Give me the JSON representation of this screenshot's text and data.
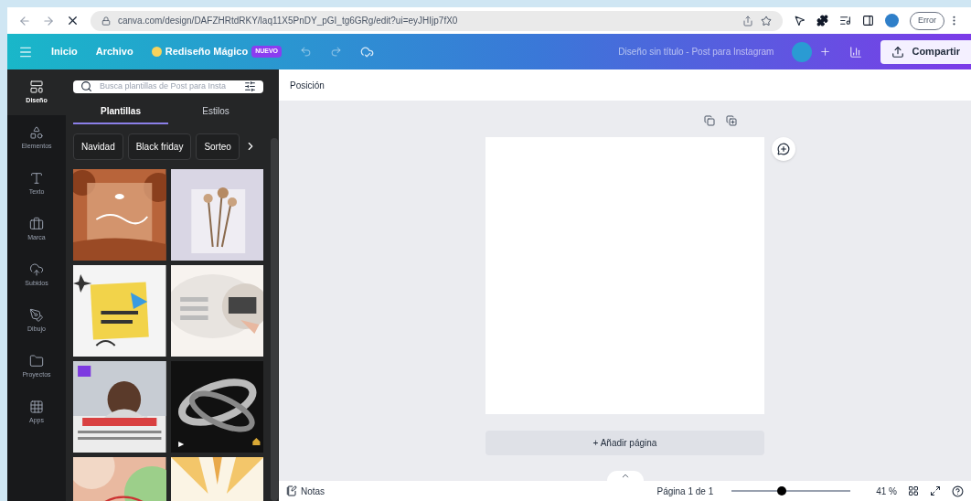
{
  "browser": {
    "url": "canva.com/design/DAFZHRtdRKY/laq11X5PnDY_pGI_tg6GRg/edit?ui=eyJHIjp7fX0",
    "profile_button": "Error"
  },
  "toolbar": {
    "menu": [
      "Inicio",
      "Archivo"
    ],
    "magic": {
      "label": "Rediseño Mágico",
      "badge": "NUEVO"
    },
    "title": "Diseño sin título - Post para Instagram",
    "share": "Compartir"
  },
  "rail": [
    {
      "kind": "design",
      "label": "Diseño",
      "selected": true
    },
    {
      "kind": "elements",
      "label": "Elementos",
      "selected": false
    },
    {
      "kind": "text",
      "label": "Texto",
      "selected": false
    },
    {
      "kind": "brand",
      "label": "Marca",
      "selected": false
    },
    {
      "kind": "uploads",
      "label": "Subidos",
      "selected": false
    },
    {
      "kind": "draw",
      "label": "Dibujo",
      "selected": false
    },
    {
      "kind": "projects",
      "label": "Proyectos",
      "selected": false
    },
    {
      "kind": "apps",
      "label": "Apps",
      "selected": false
    }
  ],
  "panel": {
    "search": {
      "placeholder": "Busca plantillas de Post para Insta"
    },
    "tabs": [
      {
        "label": "Plantillas",
        "selected": true
      },
      {
        "label": "Estilos",
        "selected": false
      }
    ],
    "chips": [
      "Navidad",
      "Black friday",
      "Sorteo"
    ]
  },
  "canvas": {
    "context_label": "Posición",
    "add_page": "+ Añadir página"
  },
  "status_bar": {
    "notes": "Notas",
    "page": "Página 1 de 1",
    "zoom": {
      "level": 0.42
    },
    "zoom_reading": "41 %"
  }
}
